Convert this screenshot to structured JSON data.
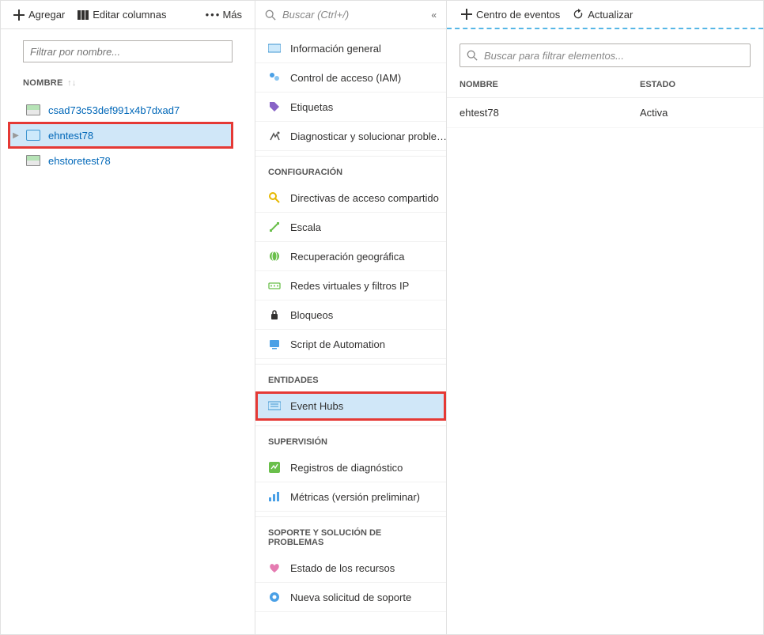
{
  "panel1": {
    "toolbar": {
      "add": "Agregar",
      "edit_columns": "Editar columnas",
      "more": "Más"
    },
    "filter_placeholder": "Filtrar por nombre...",
    "col_name": "NOMBRE",
    "resources": [
      {
        "name": "csad73c53def991x4b7dxad7",
        "icon": "storage",
        "selected": false,
        "highlighted": false
      },
      {
        "name": "ehntest78",
        "icon": "eventhub",
        "selected": true,
        "highlighted": true
      },
      {
        "name": "ehstoretest78",
        "icon": "storage",
        "selected": false,
        "highlighted": false
      }
    ]
  },
  "panel2": {
    "search_placeholder": "Buscar (Ctrl+/)",
    "sections": [
      {
        "title": "",
        "items": [
          {
            "label": "Información general",
            "icon": "overview",
            "selected": false,
            "highlighted": false
          },
          {
            "label": "Control de acceso (IAM)",
            "icon": "iam",
            "selected": false,
            "highlighted": false
          },
          {
            "label": "Etiquetas",
            "icon": "tag",
            "selected": false,
            "highlighted": false
          },
          {
            "label": "Diagnosticar y solucionar proble…",
            "icon": "diagnose",
            "selected": false,
            "highlighted": false
          }
        ]
      },
      {
        "title": "CONFIGURACIÓN",
        "items": [
          {
            "label": "Directivas de acceso compartido",
            "icon": "key",
            "selected": false,
            "highlighted": false
          },
          {
            "label": "Escala",
            "icon": "scale",
            "selected": false,
            "highlighted": false
          },
          {
            "label": "Recuperación geográfica",
            "icon": "geo",
            "selected": false,
            "highlighted": false
          },
          {
            "label": "Redes virtuales y filtros IP",
            "icon": "vnet",
            "selected": false,
            "highlighted": false
          },
          {
            "label": "Bloqueos",
            "icon": "lock",
            "selected": false,
            "highlighted": false
          },
          {
            "label": "Script de Automation",
            "icon": "automation",
            "selected": false,
            "highlighted": false
          }
        ]
      },
      {
        "title": "ENTIDADES",
        "items": [
          {
            "label": "Event Hubs",
            "icon": "eventhub",
            "selected": true,
            "highlighted": true
          }
        ]
      },
      {
        "title": "SUPERVISIÓN",
        "items": [
          {
            "label": "Registros de diagnóstico",
            "icon": "diaglogs",
            "selected": false,
            "highlighted": false
          },
          {
            "label": "Métricas (versión preliminar)",
            "icon": "metrics",
            "selected": false,
            "highlighted": false
          }
        ]
      },
      {
        "title": "SOPORTE Y SOLUCIÓN DE PROBLEMAS",
        "items": [
          {
            "label": "Estado de los recursos",
            "icon": "health",
            "selected": false,
            "highlighted": false
          },
          {
            "label": "Nueva solicitud de soporte",
            "icon": "support",
            "selected": false,
            "highlighted": false
          }
        ]
      }
    ]
  },
  "panel3": {
    "toolbar": {
      "event_center": "Centro de eventos",
      "refresh": "Actualizar"
    },
    "search_placeholder": "Buscar para filtrar elementos...",
    "columns": {
      "name": "NOMBRE",
      "state": "ESTADO"
    },
    "rows": [
      {
        "name": "ehtest78",
        "state": "Activa"
      }
    ]
  }
}
